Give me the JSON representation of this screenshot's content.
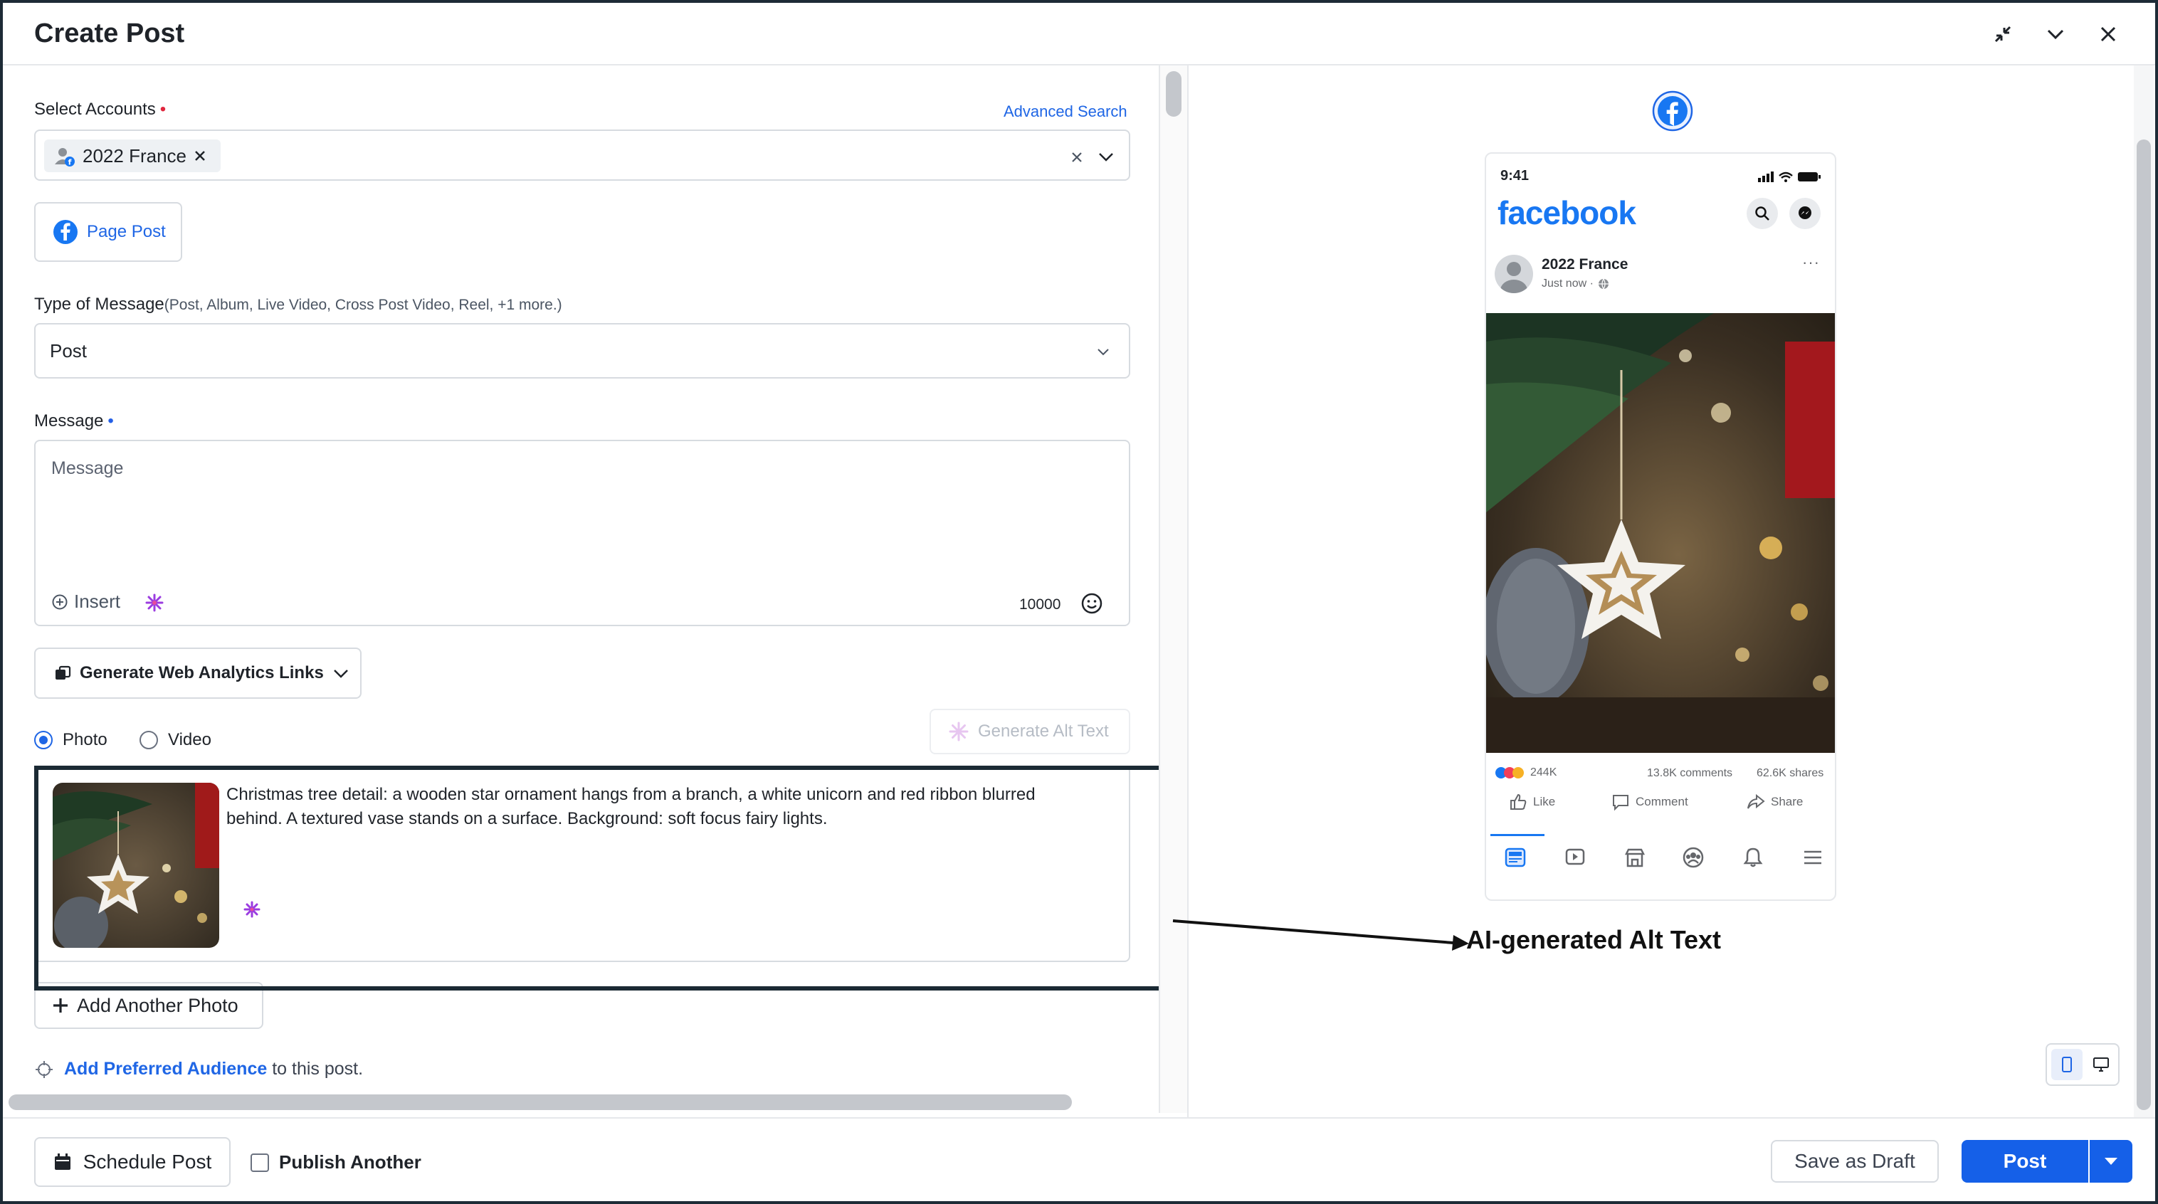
{
  "header": {
    "title": "Create Post"
  },
  "select_accounts": {
    "label": "Select Accounts",
    "advanced_search": "Advanced Search",
    "chip_label": "2022 France"
  },
  "page_post_button": "Page Post",
  "message_type": {
    "label": "Type of Message",
    "hint": "(Post, Album, Live Video, Cross Post Video, Reel, +1 more.)",
    "value": "Post"
  },
  "message": {
    "label": "Message",
    "placeholder": "Message",
    "insert_label": "Insert",
    "char_count": "10000"
  },
  "analytics_button": "Generate Web Analytics Links",
  "media_type": {
    "photo": "Photo",
    "video": "Video",
    "selected": "Photo"
  },
  "generate_alt_text": "Generate Alt Text",
  "alt_text": "Christmas tree detail: a wooden star ornament hangs from a branch, a white unicorn and red ribbon blurred behind. A textured vase stands on a surface. Background: soft focus fairy lights.",
  "add_photo": "Add Another Photo",
  "audience": {
    "link": "Add Preferred Audience",
    "suffix": " to this post."
  },
  "annotation": "AI-generated Alt Text",
  "preview": {
    "time": "9:41",
    "brand": "facebook",
    "account": "2022 France",
    "when": "Just now ·",
    "reactions": "244K",
    "comments": "13.8K comments",
    "shares": "62.6K shares",
    "like": "Like",
    "comment": "Comment",
    "share": "Share"
  },
  "footer": {
    "schedule": "Schedule Post",
    "publish_another": "Publish Another",
    "save_draft": "Save as Draft",
    "post": "Post"
  },
  "colors": {
    "accent": "#1560e8",
    "facebook": "#1877f2",
    "required": "#e0263d"
  }
}
